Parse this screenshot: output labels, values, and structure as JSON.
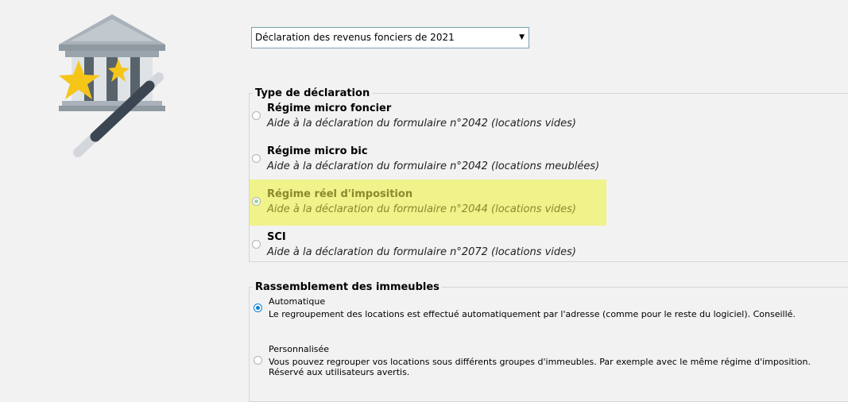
{
  "declaration_select": {
    "value": "Déclaration des revenus fonciers de 2021"
  },
  "type_section": {
    "legend": "Type de déclaration",
    "options": [
      {
        "title": "Régime micro foncier",
        "desc": "Aide à la déclaration du formulaire n°2042 (locations vides)"
      },
      {
        "title": "Régime micro bic",
        "desc": "Aide à la déclaration du formulaire n°2042 (locations meublées)"
      },
      {
        "title": "Régime réel d'imposition",
        "desc": "Aide à la déclaration du formulaire n°2044 (locations vides)"
      },
      {
        "title": "SCI",
        "desc": "Aide à la déclaration du formulaire n°2072 (locations vides)"
      }
    ]
  },
  "group_section": {
    "legend": "Rassemblement des immeubles",
    "options": [
      {
        "title": "Automatique",
        "desc": "Le regroupement des locations est effectué automatiquement par l'adresse (comme pour le reste du logiciel). Conseillé."
      },
      {
        "title": "Personnalisée",
        "desc_line1": "Vous pouvez regrouper vos locations sous différents groupes d'immeubles. Par exemple avec le même régime d'imposition.",
        "desc_line2": "Réservé aux utilisateurs avertis."
      }
    ]
  },
  "colors": {
    "highlight": "#f0f28a",
    "accent": "#0a7fd4"
  },
  "icons": {
    "logo": "bank-magic-wand-icon"
  }
}
